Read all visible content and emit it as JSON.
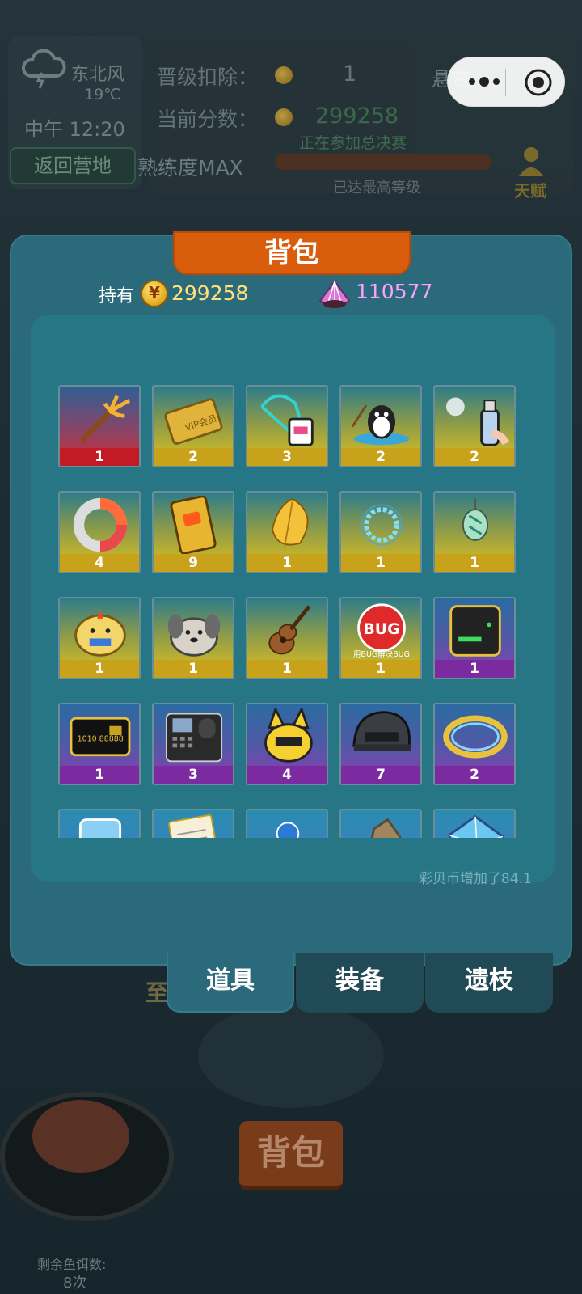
{
  "hud": {
    "wind": "东北风",
    "temperature": "19℃",
    "time": "中午 12:20",
    "return_button": "返回营地",
    "promotion_label": "晋级扣除：",
    "promotion_value": "1",
    "current_score_label": "当前分数：",
    "current_score_value": "299258",
    "final_status": "正在参加总决赛",
    "proficiency": "熟练度MAX",
    "max_level": "已达最高等级",
    "talent": "天赋",
    "reward_label": "悬赏"
  },
  "modal": {
    "title": "背包",
    "hold_label": "持有",
    "coins": "299258",
    "shells": "110577",
    "shell_increase": "彩贝币增加了84.1"
  },
  "items": [
    {
      "name": "trident",
      "count": "1",
      "rarity": "red"
    },
    {
      "name": "vip-card",
      "count": "2",
      "rarity": "gold"
    },
    {
      "name": "lanyard-badge",
      "count": "3",
      "rarity": "gold"
    },
    {
      "name": "penguin-fishing",
      "count": "2",
      "rarity": "gold"
    },
    {
      "name": "spray-can",
      "count": "2",
      "rarity": "gold"
    },
    {
      "name": "donut-ring",
      "count": "4",
      "rarity": "gold"
    },
    {
      "name": "video-phone",
      "count": "9",
      "rarity": "gold"
    },
    {
      "name": "golden-leaf",
      "count": "1",
      "rarity": "gold"
    },
    {
      "name": "blue-halo",
      "count": "1",
      "rarity": "gold"
    },
    {
      "name": "jade-pendant",
      "count": "1",
      "rarity": "gold"
    },
    {
      "name": "yellow-chick",
      "count": "1",
      "rarity": "gold"
    },
    {
      "name": "gray-puppy",
      "count": "1",
      "rarity": "gold"
    },
    {
      "name": "guitar",
      "count": "1",
      "rarity": "gold"
    },
    {
      "name": "bug-badge",
      "count": "1",
      "rarity": "gold",
      "text_top": "BUG",
      "text_bottom": "用BUG解决BUG"
    },
    {
      "name": "router-box",
      "count": "1",
      "rarity": "purple"
    },
    {
      "name": "black-card",
      "count": "1",
      "rarity": "purple"
    },
    {
      "name": "fingerprint-machine",
      "count": "3",
      "rarity": "purple"
    },
    {
      "name": "pikachu-cat",
      "count": "4",
      "rarity": "purple"
    },
    {
      "name": "helmet",
      "count": "7",
      "rarity": "purple"
    },
    {
      "name": "diamond-ring",
      "count": "2",
      "rarity": "purple"
    },
    {
      "name": "backstage-card",
      "count": "",
      "rarity": "blue"
    },
    {
      "name": "paper-scroll",
      "count": "",
      "rarity": "blue"
    },
    {
      "name": "orb-chest",
      "count": "",
      "rarity": "blue"
    },
    {
      "name": "rock",
      "count": "",
      "rarity": "blue"
    },
    {
      "name": "crystal",
      "count": "",
      "rarity": "blue"
    }
  ],
  "tabs": [
    {
      "label": "道具",
      "active": true
    },
    {
      "label": "装备",
      "active": false
    },
    {
      "label": "遗枝",
      "active": false
    }
  ],
  "bottom": {
    "bag_button": "背包",
    "bait_label": "剩余鱼饵数:",
    "bait_count": "8次",
    "partial_text": "至"
  }
}
